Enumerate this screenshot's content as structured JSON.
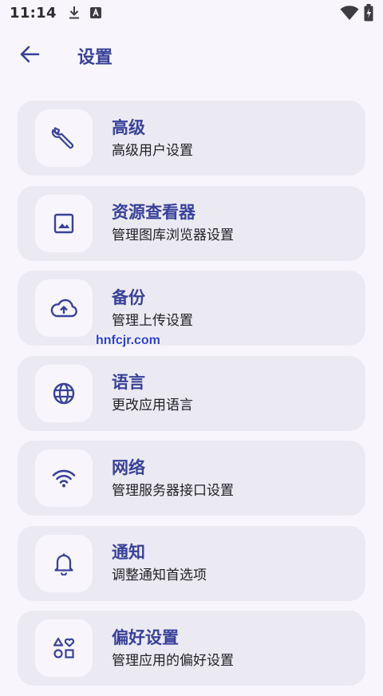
{
  "status_bar": {
    "time": "11:14",
    "left_icons": [
      "download-icon",
      "a-badge-icon"
    ],
    "right_icons": [
      "wifi-icon",
      "battery-icon"
    ]
  },
  "app_bar": {
    "back_icon": "arrow-left-icon",
    "title": "设置"
  },
  "settings": [
    {
      "id": "advanced",
      "icon": "wrench-icon",
      "title": "高级",
      "subtitle": "高级用户设置"
    },
    {
      "id": "resource-viewer",
      "icon": "image-icon",
      "title": "资源查看器",
      "subtitle": "管理图库浏览器设置"
    },
    {
      "id": "backup",
      "icon": "cloud-upload-icon",
      "title": "备份",
      "subtitle": "管理上传设置"
    },
    {
      "id": "language",
      "icon": "globe-icon",
      "title": "语言",
      "subtitle": "更改应用语言"
    },
    {
      "id": "network",
      "icon": "wifi-icon",
      "title": "网络",
      "subtitle": "管理服务器接口设置"
    },
    {
      "id": "notifications",
      "icon": "bell-icon",
      "title": "通知",
      "subtitle": "调整通知首选项"
    },
    {
      "id": "preferences",
      "icon": "shapes-icon",
      "title": "偏好设置",
      "subtitle": "管理应用的偏好设置"
    }
  ],
  "watermark": "hnfcjr.com",
  "colors": {
    "accent": "#39419a",
    "card_background": "#ebeaf2",
    "page_background": "#f8f6fc"
  }
}
